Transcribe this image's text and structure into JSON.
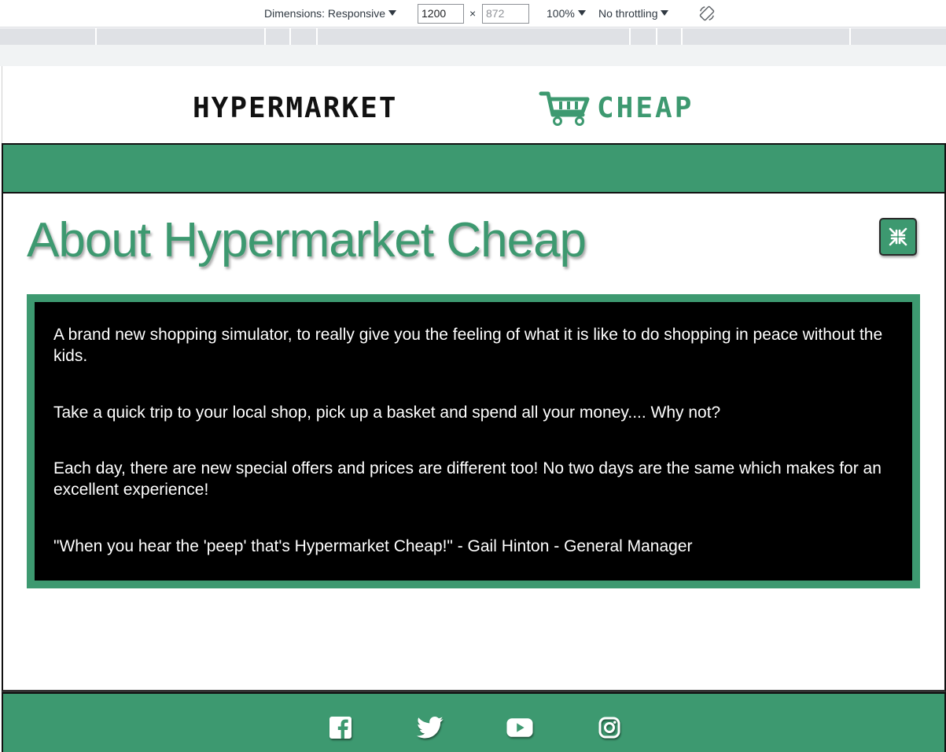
{
  "devtools": {
    "dimensions_label": "Dimensions: Responsive",
    "width_value": "1200",
    "height_placeholder": "872",
    "times_symbol": "×",
    "zoom_label": "100%",
    "throttling_label": "No throttling",
    "rotate_icon": "rotate-icon"
  },
  "header": {
    "logo_text_left": "HYPERMARKET",
    "logo_text_right": "CHEAP",
    "logo_icon": "shopping-cart-icon"
  },
  "main": {
    "title": "About Hypermarket Cheap",
    "close_icon": "collapse-arrows-icon",
    "paragraphs": [
      "A brand new shopping simulator, to really give you the feeling of what it is like to do shopping in peace without the kids.",
      "Take a quick trip to your local shop, pick up a basket and spend all your money.... Why not?",
      "Each day, there are new special offers and prices are different too! No two days are the same which makes for an excellent experience!",
      "\"When you hear the 'peep' that's Hypermarket Cheap!\" - Gail Hinton - General Manager"
    ]
  },
  "footer": {
    "social": [
      "facebook-icon",
      "twitter-icon",
      "youtube-icon",
      "instagram-icon"
    ]
  },
  "colors": {
    "brand_green": "#3d9970",
    "about_bg": "#000000",
    "text_light": "#ffffff"
  }
}
